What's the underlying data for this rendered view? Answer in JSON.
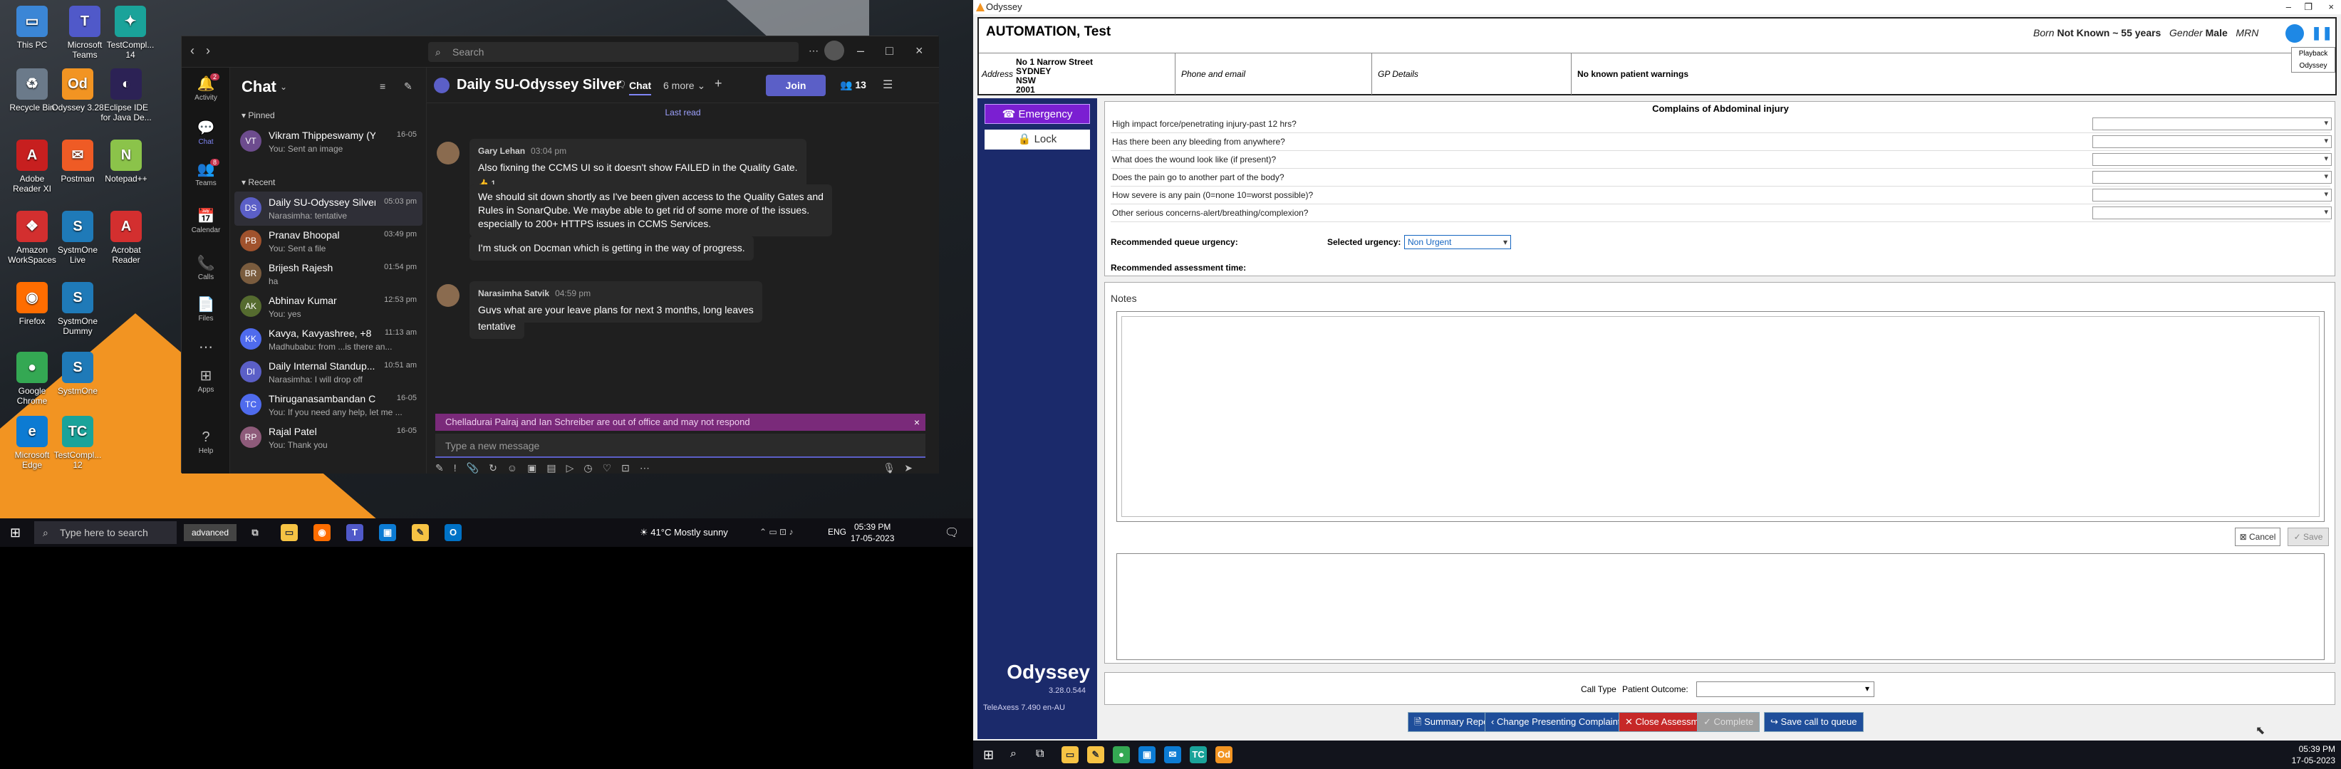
{
  "desktop_icons": [
    {
      "label": "This PC",
      "color": "#3b86d6",
      "glyph": "▭"
    },
    {
      "label": "Microsoft Teams",
      "color": "#5059c9",
      "glyph": "T"
    },
    {
      "label": "TestCompl... 14",
      "color": "#1aa39a",
      "glyph": "✦"
    },
    {
      "label": "Recycle Bin",
      "color": "#6b7a8a",
      "glyph": "♻"
    },
    {
      "label": "Odyssey 3.28",
      "color": "#f29422",
      "glyph": "Od"
    },
    {
      "label": "Eclipse IDE for Java De...",
      "color": "#2c2255",
      "glyph": "◐"
    },
    {
      "label": "Adobe Reader XI",
      "color": "#c71f1f",
      "glyph": "A"
    },
    {
      "label": "Postman",
      "color": "#ef5b25",
      "glyph": "✉"
    },
    {
      "label": "Notepad++",
      "color": "#8bc34a",
      "glyph": "N"
    },
    {
      "label": "Amazon WorkSpaces",
      "color": "#d32f2f",
      "glyph": "❖"
    },
    {
      "label": "SystmOne Live",
      "color": "#1f7ab8",
      "glyph": "S"
    },
    {
      "label": "Acrobat Reader",
      "color": "#d32f2f",
      "glyph": "A"
    },
    {
      "label": "Firefox",
      "color": "#ff6d00",
      "glyph": "◉"
    },
    {
      "label": "SystmOne Dummy",
      "color": "#1f7ab8",
      "glyph": "S"
    },
    {
      "label": "Google Chrome",
      "color": "#34a853",
      "glyph": "●"
    },
    {
      "label": "SystmOne",
      "color": "#1f7ab8",
      "glyph": "S"
    },
    {
      "label": "Microsoft Edge",
      "color": "#0c7bd3",
      "glyph": "e"
    },
    {
      "label": "TestCompl... 12",
      "color": "#1aa39a",
      "glyph": "TC"
    }
  ],
  "teams": {
    "search_placeholder": "Search",
    "rail": [
      {
        "icon": "🔔",
        "label": "Activity",
        "badge": "2"
      },
      {
        "icon": "💬",
        "label": "Chat"
      },
      {
        "icon": "👥",
        "label": "Teams",
        "badge": "8"
      },
      {
        "icon": "📅",
        "label": "Calendar"
      },
      {
        "icon": "📞",
        "label": "Calls"
      },
      {
        "icon": "📄",
        "label": "Files"
      },
      {
        "icon": "⋯",
        "label": ""
      },
      {
        "icon": "⊞",
        "label": "Apps"
      },
      {
        "icon": "?",
        "label": "Help"
      }
    ],
    "chat_heading": "Chat",
    "pinned_label": "Pinned",
    "recent_label": "Recent",
    "chats": [
      {
        "name": "Vikram Thippeswamy (Yo...",
        "preview": "You: Sent an image",
        "time": "16-05",
        "initials": "VT",
        "color": "#6d4c8e"
      },
      {
        "name": "Daily SU-Odyssey Silver",
        "preview": "Narasimha: tentative",
        "time": "05:03 pm",
        "initials": "DS",
        "color": "#5b5fc7"
      },
      {
        "name": "Pranav Bhoopal",
        "preview": "You: Sent a file",
        "time": "03:49 pm",
        "initials": "PB",
        "color": "#a0522d"
      },
      {
        "name": "Brijesh Rajesh",
        "preview": "ha",
        "time": "01:54 pm",
        "initials": "BR",
        "color": "#7a5c3e"
      },
      {
        "name": "Abhinav Kumar",
        "preview": "You: yes",
        "time": "12:53 pm",
        "initials": "AK",
        "color": "#556b2f"
      },
      {
        "name": "Kavya, Kavyashree, +8",
        "preview": "Madhubabu: from ...is there an...",
        "time": "11:13 am",
        "initials": "KK",
        "color": "#4f6bed"
      },
      {
        "name": "Daily Internal Standup...",
        "preview": "Narasimha: I will drop off",
        "time": "10:51 am",
        "initials": "DI",
        "color": "#5b5fc7"
      },
      {
        "name": "Thiruganasambandan Ch...",
        "preview": "You: If you need any help, let me ...",
        "time": "16-05",
        "initials": "TC",
        "color": "#4f6bed"
      },
      {
        "name": "Rajal Patel",
        "preview": "You: Thank you",
        "time": "16-05",
        "initials": "RP",
        "color": "#8e5b7a"
      }
    ],
    "conversation": {
      "title": "Daily SU-Odyssey Silver",
      "tab": "Chat",
      "more": "6 more ⌄",
      "join": "Join",
      "participants": "13",
      "last_read": "Last read",
      "messages": [
        {
          "author": "Gary Lehan",
          "time": "03:04 pm",
          "lines": [
            "Also fixning the CCMS UI so it doesn't show FAILED in the Quality Gate."
          ]
        },
        {
          "author": "",
          "time": "",
          "lines": [
            "We should sit down shortly as I've been given access to the Quality Gates and",
            "Rules in SonarQube. We maybe able to get rid of some more of the issues.",
            "especially to 200+ HTTPS issues in CCMS Services."
          ]
        },
        {
          "author": "",
          "time": "",
          "lines": [
            "I'm stuck on Docman which is getting in the way of progress."
          ]
        },
        {
          "author": "Narasimha Satvik",
          "time": "04:59 pm",
          "lines": [
            "Guys what are your leave plans for next 3 months, long leaves"
          ]
        },
        {
          "author": "",
          "time": "",
          "lines": [
            "tentative"
          ]
        }
      ],
      "reaction": "👍 1",
      "ooo_notice": "Chelladurai Palraj and Ian Schreiber are out of office and may not respond",
      "compose_placeholder": "Type a new message"
    }
  },
  "taskbar1": {
    "search_placeholder": "Type here to search",
    "advanced": "advanced",
    "weather": "41°C  Mostly sunny",
    "lang": "ENG",
    "time": "05:39 PM",
    "date": "17-05-2023"
  },
  "odyssey": {
    "window_title": "Odyssey",
    "patient": {
      "name": "AUTOMATION, Test",
      "born_label": "Born",
      "born_value": "Not Known ~ 55 years",
      "gender_label": "Gender",
      "gender_value": "Male",
      "mrn_label": "MRN",
      "address_label": "Address",
      "address_lines": [
        "No 1 Narrow Street",
        "SYDNEY",
        "NSW",
        "2001"
      ],
      "phone_label": "Phone and email",
      "gp_label": "GP Details",
      "warnings": "No known patient warnings"
    },
    "playback_tooltip": [
      "Playback",
      "Odyssey"
    ],
    "left_panel": {
      "emergency": "Emergency",
      "lock": "Lock",
      "brand": "Odyssey",
      "version": "3.28.0.544",
      "teleaxess": "TeleAxess 7.490 en-AU"
    },
    "assessment": {
      "title": "Complains of Abdominal injury",
      "questions": [
        "High impact force/penetrating injury-past 12 hrs?",
        "Has there been any bleeding from anywhere?",
        "What does the wound look like (if present)?",
        "Does the pain go to another part of the body?",
        "How severe is any pain (0=none 10=worst possible)?",
        "Other serious concerns-alert/breathing/complexion?"
      ],
      "recommended_queue_label": "Recommended queue urgency:",
      "selected_urgency_label": "Selected urgency:",
      "selected_urgency_value": "Non Urgent",
      "recommended_time_label": "Recommended assessment time:"
    },
    "notes": {
      "label": "Notes",
      "cancel": "Cancel",
      "save": "Save"
    },
    "call_type_label": "Call Type",
    "patient_outcome_label": "Patient Outcome:",
    "buttons": {
      "summary": "Summary Report",
      "change": "Change Presenting Complaint",
      "close": "Close Assessment",
      "complete": "Complete",
      "save_queue": "Save call to queue"
    }
  },
  "taskbar2": {
    "time": "05:39 PM",
    "date": "17-05-2023"
  }
}
